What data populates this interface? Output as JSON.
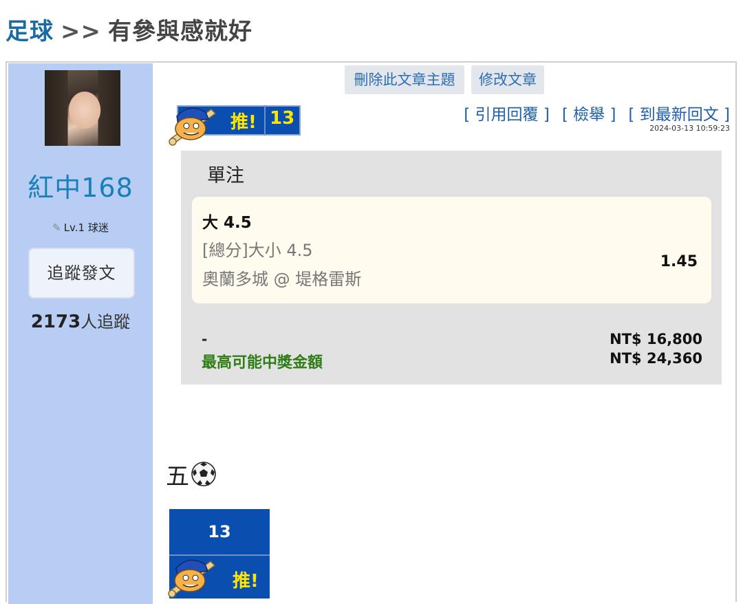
{
  "header": {
    "category": "足球",
    "separator": ">>",
    "topic": "有參與感就好"
  },
  "author": {
    "name": "紅中168",
    "level": "Lv.1 球迷",
    "follow_button": "追蹤發文",
    "followers_count": "2173",
    "followers_unit": "人追蹤"
  },
  "admin": {
    "delete_label": "刪除此文章主題",
    "edit_label": "修改文章"
  },
  "push": {
    "label": "推!",
    "count": "13"
  },
  "actions": {
    "quote": "[ 引用回覆 ]",
    "report": "[ 檢舉 ]",
    "latest": "[ 到最新回文 ]"
  },
  "timestamp": "2024-03-13 10:59:23",
  "bet": {
    "type": "單注",
    "pick": "大 4.5",
    "market": "[總分]大小 4.5",
    "match": "奧蘭多城 @ 堤格雷斯",
    "odds": "1.45",
    "stake_label": "-",
    "stake": "NT$ 16,800",
    "payout_label": "最高可能中獎金額",
    "payout": "NT$ 24,360"
  },
  "content": {
    "text": "五"
  },
  "colors": {
    "sidebar_bg": "#b7cdf3",
    "link_blue": "#1f5fa8",
    "badge_blue": "#0a4fb0",
    "badge_yellow": "#ffe500",
    "payout_green": "#2f7d16"
  }
}
